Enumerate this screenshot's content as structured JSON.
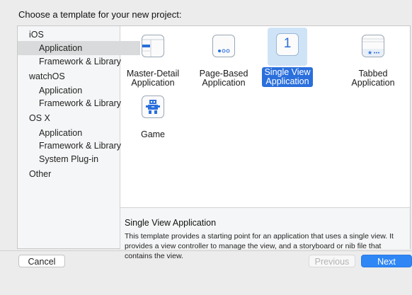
{
  "dialog": {
    "title": "Choose a template for your new project:"
  },
  "sidebar": {
    "items": [
      {
        "label": "iOS",
        "kind": "header"
      },
      {
        "label": "Application",
        "kind": "child",
        "selected": true
      },
      {
        "label": "Framework & Library",
        "kind": "child"
      },
      {
        "label": "watchOS",
        "kind": "header"
      },
      {
        "label": "Application",
        "kind": "child"
      },
      {
        "label": "Framework & Library",
        "kind": "child"
      },
      {
        "label": "OS X",
        "kind": "header"
      },
      {
        "label": "Application",
        "kind": "child"
      },
      {
        "label": "Framework & Library",
        "kind": "child"
      },
      {
        "label": "System Plug-in",
        "kind": "child"
      },
      {
        "label": "Other",
        "kind": "header"
      }
    ]
  },
  "templates": [
    {
      "label": "Master-Detail\nApplication",
      "icon": "master-detail-icon"
    },
    {
      "label": "Page-Based\nApplication",
      "icon": "page-based-icon"
    },
    {
      "label": "Single View\nApplication",
      "icon": "single-view-icon",
      "selected": true,
      "icon_text": "1"
    },
    {
      "label": "Tabbed\nApplication",
      "icon": "tabbed-icon"
    },
    {
      "label": "Game",
      "icon": "game-icon"
    }
  ],
  "description": {
    "title": "Single View Application",
    "text": "This template provides a starting point for an application that uses a single view. It provides a view controller to manage the view, and a storyboard or nib file that contains the view."
  },
  "buttons": {
    "cancel": "Cancel",
    "previous": "Previous",
    "next": "Next"
  },
  "colors": {
    "accent": "#2a6fdc",
    "next_button": "#2f86f5",
    "icon_blue": "#2a6fdc"
  }
}
